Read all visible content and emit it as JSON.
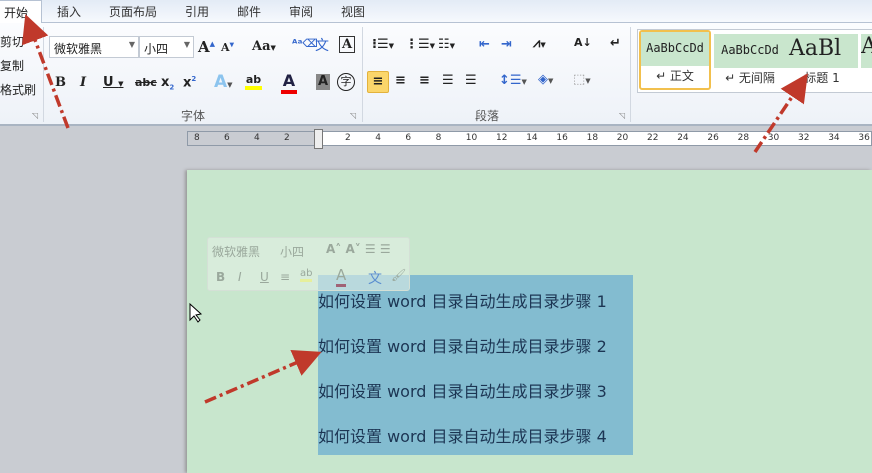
{
  "tabs": [
    "开始",
    "插入",
    "页面布局",
    "引用",
    "邮件",
    "审阅",
    "视图"
  ],
  "clipboard": {
    "cut": "剪切",
    "copy": "复制",
    "format_painter": "格式刷"
  },
  "font": {
    "name": "微软雅黑",
    "size": "小四",
    "group_label": "字体"
  },
  "paragraph": {
    "group_label": "段落"
  },
  "styles": [
    {
      "preview": "AaBbCcDd",
      "label": "↵ 正文"
    },
    {
      "preview": "AaBbCcDd",
      "label": "↵ 无间隔"
    },
    {
      "preview": "AaBl",
      "label": "标题 1"
    }
  ],
  "ruler": {
    "left": [
      "8",
      "6",
      "4",
      "2"
    ],
    "right": [
      "2",
      "4",
      "6",
      "8",
      "10",
      "12",
      "14",
      "16",
      "18",
      "20",
      "22",
      "24",
      "26",
      "28",
      "30",
      "32",
      "34",
      "36"
    ]
  },
  "mini_toolbar": {
    "font": "微软雅黑",
    "size": "小四"
  },
  "document": {
    "lines": [
      "如何设置 word 目录自动生成目录步骤 1",
      "如何设置 word 目录自动生成目录步骤 2",
      "如何设置 word 目录自动生成目录步骤 3",
      "如何设置 word 目录自动生成目录步骤 4"
    ]
  },
  "colors": {
    "page": "#c8e6cd",
    "selection": "#83bcd0",
    "arrow": "#c0392b"
  }
}
